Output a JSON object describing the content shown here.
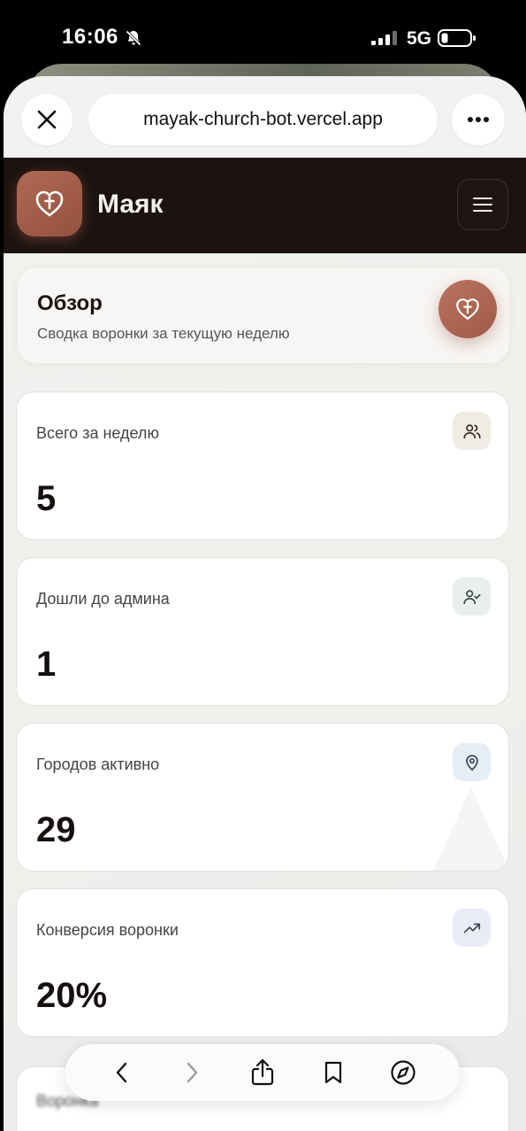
{
  "status_bar": {
    "time": "16:06",
    "network": "5G"
  },
  "browser": {
    "url": "mayak-church-bot.vercel.app"
  },
  "app": {
    "title": "Маяк"
  },
  "overview": {
    "title": "Обзор",
    "subtitle": "Сводка воронки за текущую неделю"
  },
  "stats": [
    {
      "label": "Всего за неделю",
      "value": "5",
      "icon": "users-icon",
      "icon_bg": "#f1ebe6"
    },
    {
      "label": "Дошли до админа",
      "value": "1",
      "icon": "user-check-icon",
      "icon_bg": "#e8efec"
    },
    {
      "label": "Городов активно",
      "value": "29",
      "icon": "map-pin-icon",
      "icon_bg": "#e6edf7"
    },
    {
      "label": "Конверсия воронки",
      "value": "20%",
      "icon": "trending-up-icon",
      "icon_bg": "#e8ecf7"
    }
  ],
  "partial_section": {
    "label": "Воронка"
  },
  "colors": {
    "accent": "#a86250",
    "header_bg": "#1c1310",
    "text": "#15100e"
  }
}
